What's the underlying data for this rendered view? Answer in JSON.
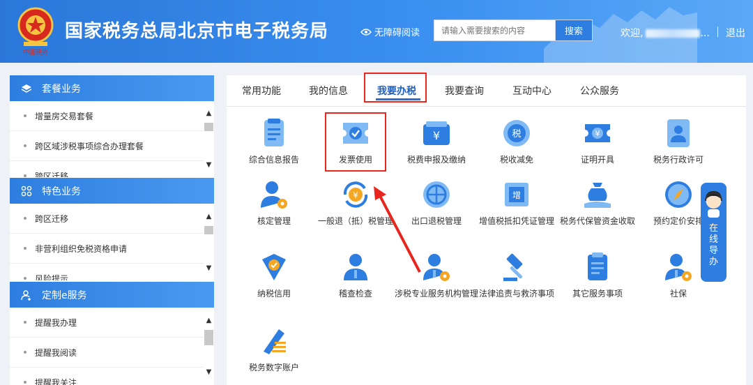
{
  "header": {
    "site_title": "国家税务总局北京市电子税务局",
    "accessibility": "无障碍阅读",
    "search_placeholder": "请输入需要搜索的内容",
    "search_button": "搜索",
    "welcome": "欢迎,",
    "welcome_suffix": "...",
    "logout": "退出"
  },
  "sidebar": {
    "sections": [
      {
        "title": "套餐业务",
        "items": [
          "增量房交易套餐",
          "跨区域涉税事项综合办理套餐",
          "跨区迁移"
        ]
      },
      {
        "title": "特色业务",
        "items": [
          "跨区迁移",
          "非营利组织免税资格申请",
          "风险提示"
        ]
      },
      {
        "title": "定制e服务",
        "items": [
          "提醒我办理",
          "提醒我阅读",
          "提醒我关注"
        ]
      }
    ]
  },
  "tabs": [
    "常用功能",
    "我的信息",
    "我要办税",
    "我要查询",
    "互动中心",
    "公众服务"
  ],
  "active_tab": "我要办税",
  "tiles": [
    {
      "label": "综合信息报告",
      "icon": "report-doc-icon"
    },
    {
      "label": "发票使用",
      "icon": "invoice-ticket-icon"
    },
    {
      "label": "税费申报及缴纳",
      "icon": "tax-payment-icon"
    },
    {
      "label": "税收减免",
      "icon": "tax-reduction-icon"
    },
    {
      "label": "证明开具",
      "icon": "certificate-icon"
    },
    {
      "label": "税务行政许可",
      "icon": "admin-permit-icon"
    },
    {
      "label": "核定管理",
      "icon": "user-gear-icon"
    },
    {
      "label": "一般退（抵）税管理",
      "icon": "refund-cycle-icon"
    },
    {
      "label": "出口退税管理",
      "icon": "globe-export-icon"
    },
    {
      "label": "增值税抵扣凭证管理",
      "icon": "vat-voucher-icon"
    },
    {
      "label": "税务代保管资金收取",
      "icon": "money-bag-icon"
    },
    {
      "label": "预约定价安排",
      "icon": "compass-icon"
    },
    {
      "label": "纳税信用",
      "icon": "credit-shield-icon"
    },
    {
      "label": "稽查检查",
      "icon": "inspector-icon"
    },
    {
      "label": "涉税专业服务机构管理",
      "icon": "agency-person-icon"
    },
    {
      "label": "法律追责与救济事项",
      "icon": "gavel-icon"
    },
    {
      "label": "其它服务事项",
      "icon": "clipboard-icon"
    },
    {
      "label": "社保",
      "icon": "social-security-icon"
    },
    {
      "label": "税务数字账户",
      "icon": "digital-account-icon"
    }
  ],
  "helper": {
    "label": [
      "在",
      "线",
      "导",
      "办"
    ]
  },
  "colors": {
    "primary": "#2e7de0",
    "highlight": "#e8261d",
    "icon_light": "#7fbaf5"
  }
}
